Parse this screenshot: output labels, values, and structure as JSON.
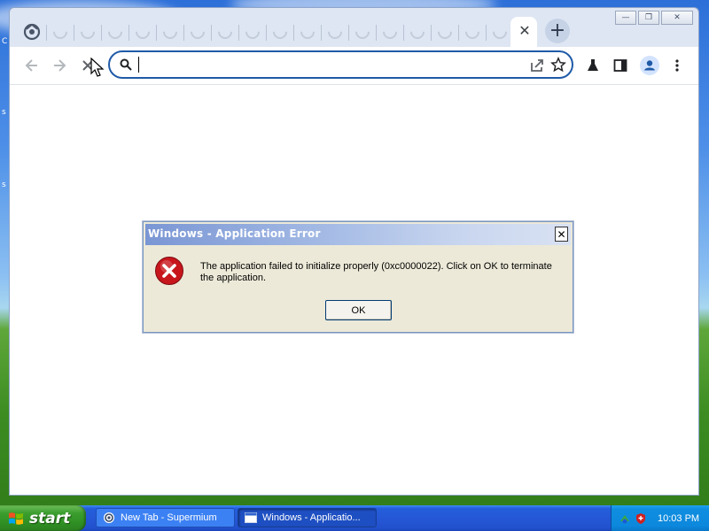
{
  "desktop": {
    "glyphs": [
      "C",
      "s",
      "s"
    ]
  },
  "browser": {
    "tab_close_glyph": "✕",
    "new_tab_glyph": "+",
    "window_controls": {
      "minimize": "—",
      "restore": "❐",
      "close": "✕"
    },
    "omnibox": {
      "value": "",
      "placeholder": ""
    }
  },
  "dialog": {
    "title": "Windows - Application Error",
    "close_glyph": "✕",
    "message": "The application failed to initialize properly (0xc0000022). Click on OK to terminate the application.",
    "ok_label": "OK",
    "icon": "error-icon",
    "title_bar_color": "#7a96d4"
  },
  "taskbar": {
    "start_label": "start",
    "tasks": [
      {
        "label": "New Tab - Supermium",
        "icon": "browser-icon"
      },
      {
        "label": "Windows - Applicatio...",
        "icon": "window-icon"
      }
    ],
    "clock": "10:03 PM"
  },
  "colors": {
    "accent": "#1f5aa8",
    "taskbar_blue": "#245edb",
    "start_green": "#3c9e2f",
    "error_red": "#c8161d"
  }
}
